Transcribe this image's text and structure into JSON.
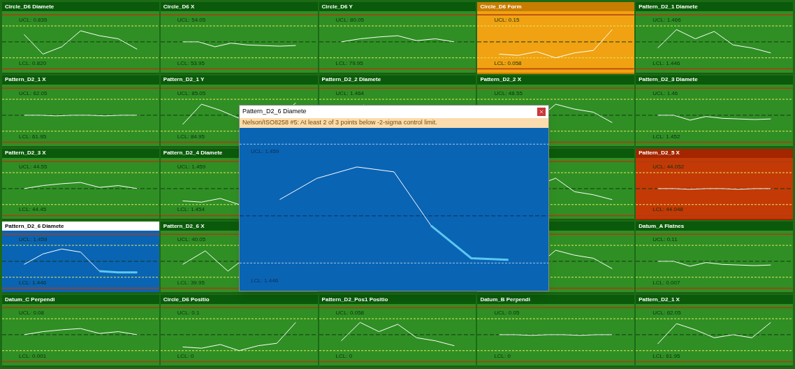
{
  "tiles": [
    {
      "title": "Circle_D6 Diamete",
      "kind": "ok",
      "selected": false,
      "ucl": "UCL: 0.835",
      "lcl": "LCL: 0.820"
    },
    {
      "title": "Circle_D6 X",
      "kind": "ok",
      "selected": false,
      "ucl": "UCL: 54.05",
      "lcl": "LCL: 53.95"
    },
    {
      "title": "Circle_D6 Y",
      "kind": "ok",
      "selected": false,
      "ucl": "UCL: 80.05",
      "lcl": "LCL: 79.95"
    },
    {
      "title": "Circle_D6 Form",
      "kind": "warning",
      "selected": false,
      "ucl": "UCL: 0.15",
      "lcl": "LCL: 0.058"
    },
    {
      "title": "Pattern_D2_1 Diamete",
      "kind": "ok",
      "selected": false,
      "ucl": "UCL: 1.466",
      "lcl": "LCL: 1.446"
    },
    {
      "title": "Pattern_D2_1 X",
      "kind": "ok",
      "selected": false,
      "ucl": "UCL: 62.05",
      "lcl": "LCL: 61.95"
    },
    {
      "title": "Pattern_D2_1 Y",
      "kind": "ok",
      "selected": false,
      "ucl": "UCL: 85.05",
      "lcl": "LCL: 84.95"
    },
    {
      "title": "Pattern_D2_2 Diamete",
      "kind": "ok",
      "selected": false,
      "ucl": "UCL: 1.464"
    },
    {
      "title": "Pattern_D2_2 X",
      "kind": "ok",
      "selected": false,
      "ucl": "UCL: 48.55"
    },
    {
      "title": "Pattern_D2_3 Diamete",
      "kind": "ok",
      "selected": false,
      "ucl": "UCL: 1.46",
      "lcl": "LCL: 1.452"
    },
    {
      "title": "Pattern_D2_3 X",
      "kind": "ok",
      "selected": false,
      "ucl": "UCL: 44.55",
      "lcl": "LCL: 44.45"
    },
    {
      "title": "Pattern_D2_4 Diamete",
      "kind": "ok",
      "selected": false,
      "ucl": "UCL: 1.459",
      "lcl": "LCL: 1.454"
    },
    {
      "kind": "ok",
      "selected": false
    },
    {
      "title": "Pattern_D2_5 X",
      "kind": "alarm",
      "selected": false,
      "ucl": "UCL: 44.052",
      "lcl": "LCL: 44.048"
    },
    {
      "title": "Pattern_D2_6 Diamete",
      "kind": "ok",
      "selected": true,
      "ucl": "UCL: 1.459",
      "lcl": "LCL: 1.446"
    },
    {
      "title": "Pattern_D2_6 X",
      "kind": "ok",
      "selected": false,
      "ucl": "UCL: 40.05",
      "lcl": "LCL: 39.95"
    },
    {
      "kind": "ok",
      "selected": false
    },
    {
      "title": "Datum_A Flatnes",
      "kind": "ok",
      "selected": false,
      "ucl": "UCL: 0.11",
      "lcl": "LCL: 0.007"
    },
    {
      "title": "Datum_C Perpendi",
      "kind": "ok",
      "selected": false,
      "ucl": "UCL: 0.08",
      "lcl": "LCL: 0.001"
    },
    {
      "title": "Circle_D6 Positio",
      "kind": "ok",
      "selected": false,
      "ucl": "UCL: 0.1",
      "lcl": "LCL: 0"
    },
    {
      "title": "Pattern_D2_Pos1 Positio",
      "kind": "ok",
      "selected": false,
      "ucl": "UCL: 0.058",
      "lcl": "LCL: 0"
    },
    {
      "title": "Datum_B Perpendi",
      "kind": "ok",
      "selected": false,
      "ucl": "UCL: 0.05",
      "lcl": "LCL: 0"
    },
    {
      "title": "Pattern_D2_1 X",
      "kind": "ok",
      "selected": false,
      "ucl": "UCL: 62.05",
      "lcl": "LCL: 61.95"
    }
  ],
  "popup": {
    "title": "Pattern_D2_6 Diamete",
    "message": "Nelson/ISO8258 #5: At least 2 of 3 points below -2-sigma control limit.",
    "ucl": "UCL: 1.459",
    "lcl": "LCL: 1.446"
  }
}
